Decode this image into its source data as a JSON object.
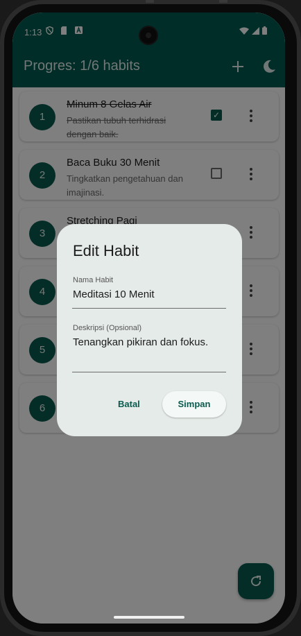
{
  "status_bar": {
    "time": "1:13",
    "icons": [
      "vpn-shield-icon",
      "sim-card-icon",
      "a-notification-icon",
      "wifi-icon",
      "signal-icon",
      "battery-icon"
    ]
  },
  "app_bar": {
    "title": "Progres: 1/6 habits",
    "add_icon": "+",
    "theme_icon": "moon"
  },
  "habits": [
    {
      "number": "1",
      "title": "Minum 8 Gelas Air",
      "description": "Pastikan tubuh terhidrasi dengan baik.",
      "done": true
    },
    {
      "number": "2",
      "title": "Baca Buku 30 Menit",
      "description": "Tingkatkan pengetahuan dan imajinasi.",
      "done": false
    },
    {
      "number": "3",
      "title": "Stretching Pagi",
      "description": "",
      "done": false
    },
    {
      "number": "4",
      "title": "",
      "description": "",
      "done": false
    },
    {
      "number": "5",
      "title": "",
      "description": "",
      "done": false
    },
    {
      "number": "6",
      "title": "",
      "description": "",
      "done": false
    }
  ],
  "dialog": {
    "title": "Edit Habit",
    "name_label": "Nama Habit",
    "name_value": "Meditasi 10 Menit",
    "desc_label": "Deskripsi (Opsional)",
    "desc_value": "Tenangkan pikiran dan fokus.",
    "cancel_label": "Batal",
    "save_label": "Simpan"
  },
  "colors": {
    "primary": "#005a4e",
    "accent": "#0b5a4e",
    "dialog_bg": "#e5ebe8"
  }
}
